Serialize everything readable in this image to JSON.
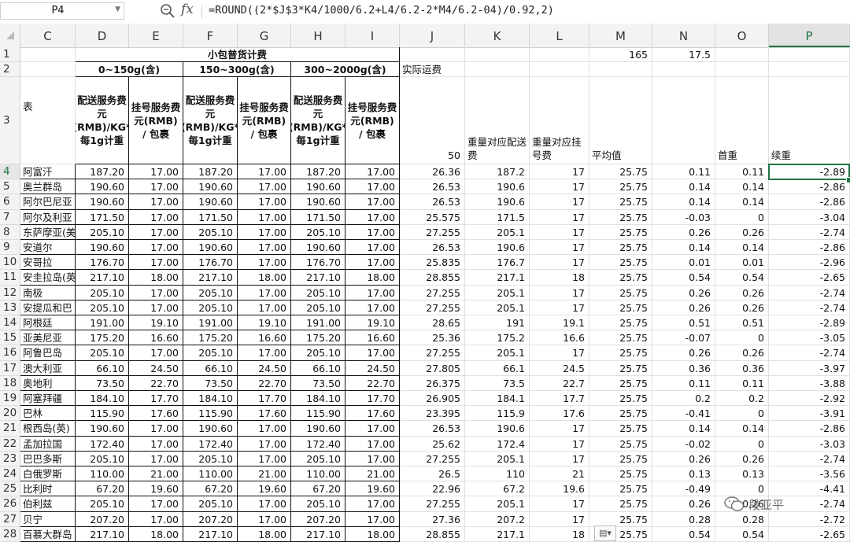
{
  "formula_bar": {
    "cell_ref": "P4",
    "formula": "=ROUND((2*$J$3*K4/1000/6.2+L4/6.2-2*M4/6.2-04)/0.92,2)"
  },
  "columns": [
    "C",
    "D",
    "E",
    "F",
    "G",
    "H",
    "I",
    "J",
    "K",
    "L",
    "M",
    "N",
    "O",
    "P"
  ],
  "selected_column": "P",
  "selected_row": "4",
  "header": {
    "title": "小包普货计费",
    "groups": [
      "0~150g(含)",
      "150~300g(含)",
      "300~2000g(含)"
    ],
    "c3_label": "表",
    "deliver_label": "配送服务费元(RMB)/KG*每1g计重",
    "register_label": "挂号服务费元(RMB) / 包裹",
    "j2": "实际运费",
    "j3": "50",
    "k3": "重量对应配送费",
    "l3": "重量对应挂号费",
    "m3": "平均值",
    "o3": "首重",
    "p3": "续重",
    "m1": "165",
    "n1": "17.5"
  },
  "rows": [
    {
      "r": "4",
      "c": "阿富汗",
      "d": "187.20",
      "e": "17.00",
      "f": "187.20",
      "g": "17.00",
      "h": "187.20",
      "i": "17.00",
      "j": "26.36",
      "k": "187.2",
      "l": "17",
      "m": "25.75",
      "n": "0.11",
      "o": "0.11",
      "p": "-2.89"
    },
    {
      "r": "5",
      "c": "奥兰群岛",
      "d": "190.60",
      "e": "17.00",
      "f": "190.60",
      "g": "17.00",
      "h": "190.60",
      "i": "17.00",
      "j": "26.53",
      "k": "190.6",
      "l": "17",
      "m": "25.75",
      "n": "0.14",
      "o": "0.14",
      "p": "-2.86"
    },
    {
      "r": "6",
      "c": "阿尔巴尼亚",
      "d": "190.60",
      "e": "17.00",
      "f": "190.60",
      "g": "17.00",
      "h": "190.60",
      "i": "17.00",
      "j": "26.53",
      "k": "190.6",
      "l": "17",
      "m": "25.75",
      "n": "0.14",
      "o": "0.14",
      "p": "-2.86"
    },
    {
      "r": "7",
      "c": "阿尔及利亚",
      "d": "171.50",
      "e": "17.00",
      "f": "171.50",
      "g": "17.00",
      "h": "171.50",
      "i": "17.00",
      "j": "25.575",
      "k": "171.5",
      "l": "17",
      "m": "25.75",
      "n": "-0.03",
      "o": "0",
      "p": "-3.04"
    },
    {
      "r": "8",
      "c": "东萨摩亚(美",
      "d": "205.10",
      "e": "17.00",
      "f": "205.10",
      "g": "17.00",
      "h": "205.10",
      "i": "17.00",
      "j": "27.255",
      "k": "205.1",
      "l": "17",
      "m": "25.75",
      "n": "0.26",
      "o": "0.26",
      "p": "-2.74"
    },
    {
      "r": "9",
      "c": "安道尔",
      "d": "190.60",
      "e": "17.00",
      "f": "190.60",
      "g": "17.00",
      "h": "190.60",
      "i": "17.00",
      "j": "26.53",
      "k": "190.6",
      "l": "17",
      "m": "25.75",
      "n": "0.14",
      "o": "0.14",
      "p": "-2.86"
    },
    {
      "r": "10",
      "c": "安哥拉",
      "d": "176.70",
      "e": "17.00",
      "f": "176.70",
      "g": "17.00",
      "h": "176.70",
      "i": "17.00",
      "j": "25.835",
      "k": "176.7",
      "l": "17",
      "m": "25.75",
      "n": "0.01",
      "o": "0.01",
      "p": "-2.96"
    },
    {
      "r": "11",
      "c": "安圭拉岛(英",
      "d": "217.10",
      "e": "18.00",
      "f": "217.10",
      "g": "18.00",
      "h": "217.10",
      "i": "18.00",
      "j": "28.855",
      "k": "217.1",
      "l": "18",
      "m": "25.75",
      "n": "0.54",
      "o": "0.54",
      "p": "-2.65"
    },
    {
      "r": "12",
      "c": "南极",
      "d": "205.10",
      "e": "17.00",
      "f": "205.10",
      "g": "17.00",
      "h": "205.10",
      "i": "17.00",
      "j": "27.255",
      "k": "205.1",
      "l": "17",
      "m": "25.75",
      "n": "0.26",
      "o": "0.26",
      "p": "-2.74"
    },
    {
      "r": "13",
      "c": "安提瓜和巴",
      "d": "205.10",
      "e": "17.00",
      "f": "205.10",
      "g": "17.00",
      "h": "205.10",
      "i": "17.00",
      "j": "27.255",
      "k": "205.1",
      "l": "17",
      "m": "25.75",
      "n": "0.26",
      "o": "0.26",
      "p": "-2.74"
    },
    {
      "r": "14",
      "c": "阿根廷",
      "d": "191.00",
      "e": "19.10",
      "f": "191.00",
      "g": "19.10",
      "h": "191.00",
      "i": "19.10",
      "j": "28.65",
      "k": "191",
      "l": "19.1",
      "m": "25.75",
      "n": "0.51",
      "o": "0.51",
      "p": "-2.89"
    },
    {
      "r": "15",
      "c": "亚美尼亚",
      "d": "175.20",
      "e": "16.60",
      "f": "175.20",
      "g": "16.60",
      "h": "175.20",
      "i": "16.60",
      "j": "25.36",
      "k": "175.2",
      "l": "16.6",
      "m": "25.75",
      "n": "-0.07",
      "o": "0",
      "p": "-3.05"
    },
    {
      "r": "16",
      "c": "阿鲁巴岛",
      "d": "205.10",
      "e": "17.00",
      "f": "205.10",
      "g": "17.00",
      "h": "205.10",
      "i": "17.00",
      "j": "27.255",
      "k": "205.1",
      "l": "17",
      "m": "25.75",
      "n": "0.26",
      "o": "0.26",
      "p": "-2.74"
    },
    {
      "r": "17",
      "c": "澳大利亚",
      "d": "66.10",
      "e": "24.50",
      "f": "66.10",
      "g": "24.50",
      "h": "66.10",
      "i": "24.50",
      "j": "27.805",
      "k": "66.1",
      "l": "24.5",
      "m": "25.75",
      "n": "0.36",
      "o": "0.36",
      "p": "-3.97"
    },
    {
      "r": "18",
      "c": "奥地利",
      "d": "73.50",
      "e": "22.70",
      "f": "73.50",
      "g": "22.70",
      "h": "73.50",
      "i": "22.70",
      "j": "26.375",
      "k": "73.5",
      "l": "22.7",
      "m": "25.75",
      "n": "0.11",
      "o": "0.11",
      "p": "-3.88"
    },
    {
      "r": "19",
      "c": "阿塞拜疆",
      "d": "184.10",
      "e": "17.70",
      "f": "184.10",
      "g": "17.70",
      "h": "184.10",
      "i": "17.70",
      "j": "26.905",
      "k": "184.1",
      "l": "17.7",
      "m": "25.75",
      "n": "0.2",
      "o": "0.2",
      "p": "-2.92"
    },
    {
      "r": "20",
      "c": "巴林",
      "d": "115.90",
      "e": "17.60",
      "f": "115.90",
      "g": "17.60",
      "h": "115.90",
      "i": "17.60",
      "j": "23.395",
      "k": "115.9",
      "l": "17.6",
      "m": "25.75",
      "n": "-0.41",
      "o": "0",
      "p": "-3.91"
    },
    {
      "r": "21",
      "c": "根西岛(英)",
      "d": "190.60",
      "e": "17.00",
      "f": "190.60",
      "g": "17.00",
      "h": "190.60",
      "i": "17.00",
      "j": "26.53",
      "k": "190.6",
      "l": "17",
      "m": "25.75",
      "n": "0.14",
      "o": "0.14",
      "p": "-2.86"
    },
    {
      "r": "22",
      "c": "孟加拉国",
      "d": "172.40",
      "e": "17.00",
      "f": "172.40",
      "g": "17.00",
      "h": "172.40",
      "i": "17.00",
      "j": "25.62",
      "k": "172.4",
      "l": "17",
      "m": "25.75",
      "n": "-0.02",
      "o": "0",
      "p": "-3.03"
    },
    {
      "r": "23",
      "c": "巴巴多斯",
      "d": "205.10",
      "e": "17.00",
      "f": "205.10",
      "g": "17.00",
      "h": "205.10",
      "i": "17.00",
      "j": "27.255",
      "k": "205.1",
      "l": "17",
      "m": "25.75",
      "n": "0.26",
      "o": "0.26",
      "p": "-2.74"
    },
    {
      "r": "24",
      "c": "白俄罗斯",
      "d": "110.00",
      "e": "21.00",
      "f": "110.00",
      "g": "21.00",
      "h": "110.00",
      "i": "21.00",
      "j": "26.5",
      "k": "110",
      "l": "21",
      "m": "25.75",
      "n": "0.13",
      "o": "0.13",
      "p": "-3.56"
    },
    {
      "r": "25",
      "c": "比利时",
      "d": "67.20",
      "e": "19.60",
      "f": "67.20",
      "g": "19.60",
      "h": "67.20",
      "i": "19.60",
      "j": "22.96",
      "k": "67.2",
      "l": "19.6",
      "m": "25.75",
      "n": "-0.49",
      "o": "0",
      "p": "-4.41"
    },
    {
      "r": "26",
      "c": "伯利兹",
      "d": "205.10",
      "e": "17.00",
      "f": "205.10",
      "g": "17.00",
      "h": "205.10",
      "i": "17.00",
      "j": "27.255",
      "k": "205.1",
      "l": "17",
      "m": "25.75",
      "n": "0.26",
      "o": "0.26",
      "p": "-2.74"
    },
    {
      "r": "27",
      "c": "贝宁",
      "d": "207.20",
      "e": "17.00",
      "f": "207.20",
      "g": "17.00",
      "h": "207.20",
      "i": "17.00",
      "j": "27.36",
      "k": "207.2",
      "l": "17",
      "m": "25.75",
      "n": "0.28",
      "o": "0.28",
      "p": "-2.72"
    },
    {
      "r": "28",
      "c": "百慕大群岛",
      "d": "217.10",
      "e": "18.00",
      "f": "217.10",
      "g": "18.00",
      "h": "217.10",
      "i": "18.00",
      "j": "28.855",
      "k": "217.1",
      "l": "18",
      "m": "25.75",
      "n": "0.54",
      "o": "0.54",
      "p": "-2.65"
    }
  ],
  "watermark": "段亚平",
  "colors": {
    "accent": "#217346",
    "header_bg": "#f3f3f3",
    "grid": "#e0e0e0"
  }
}
